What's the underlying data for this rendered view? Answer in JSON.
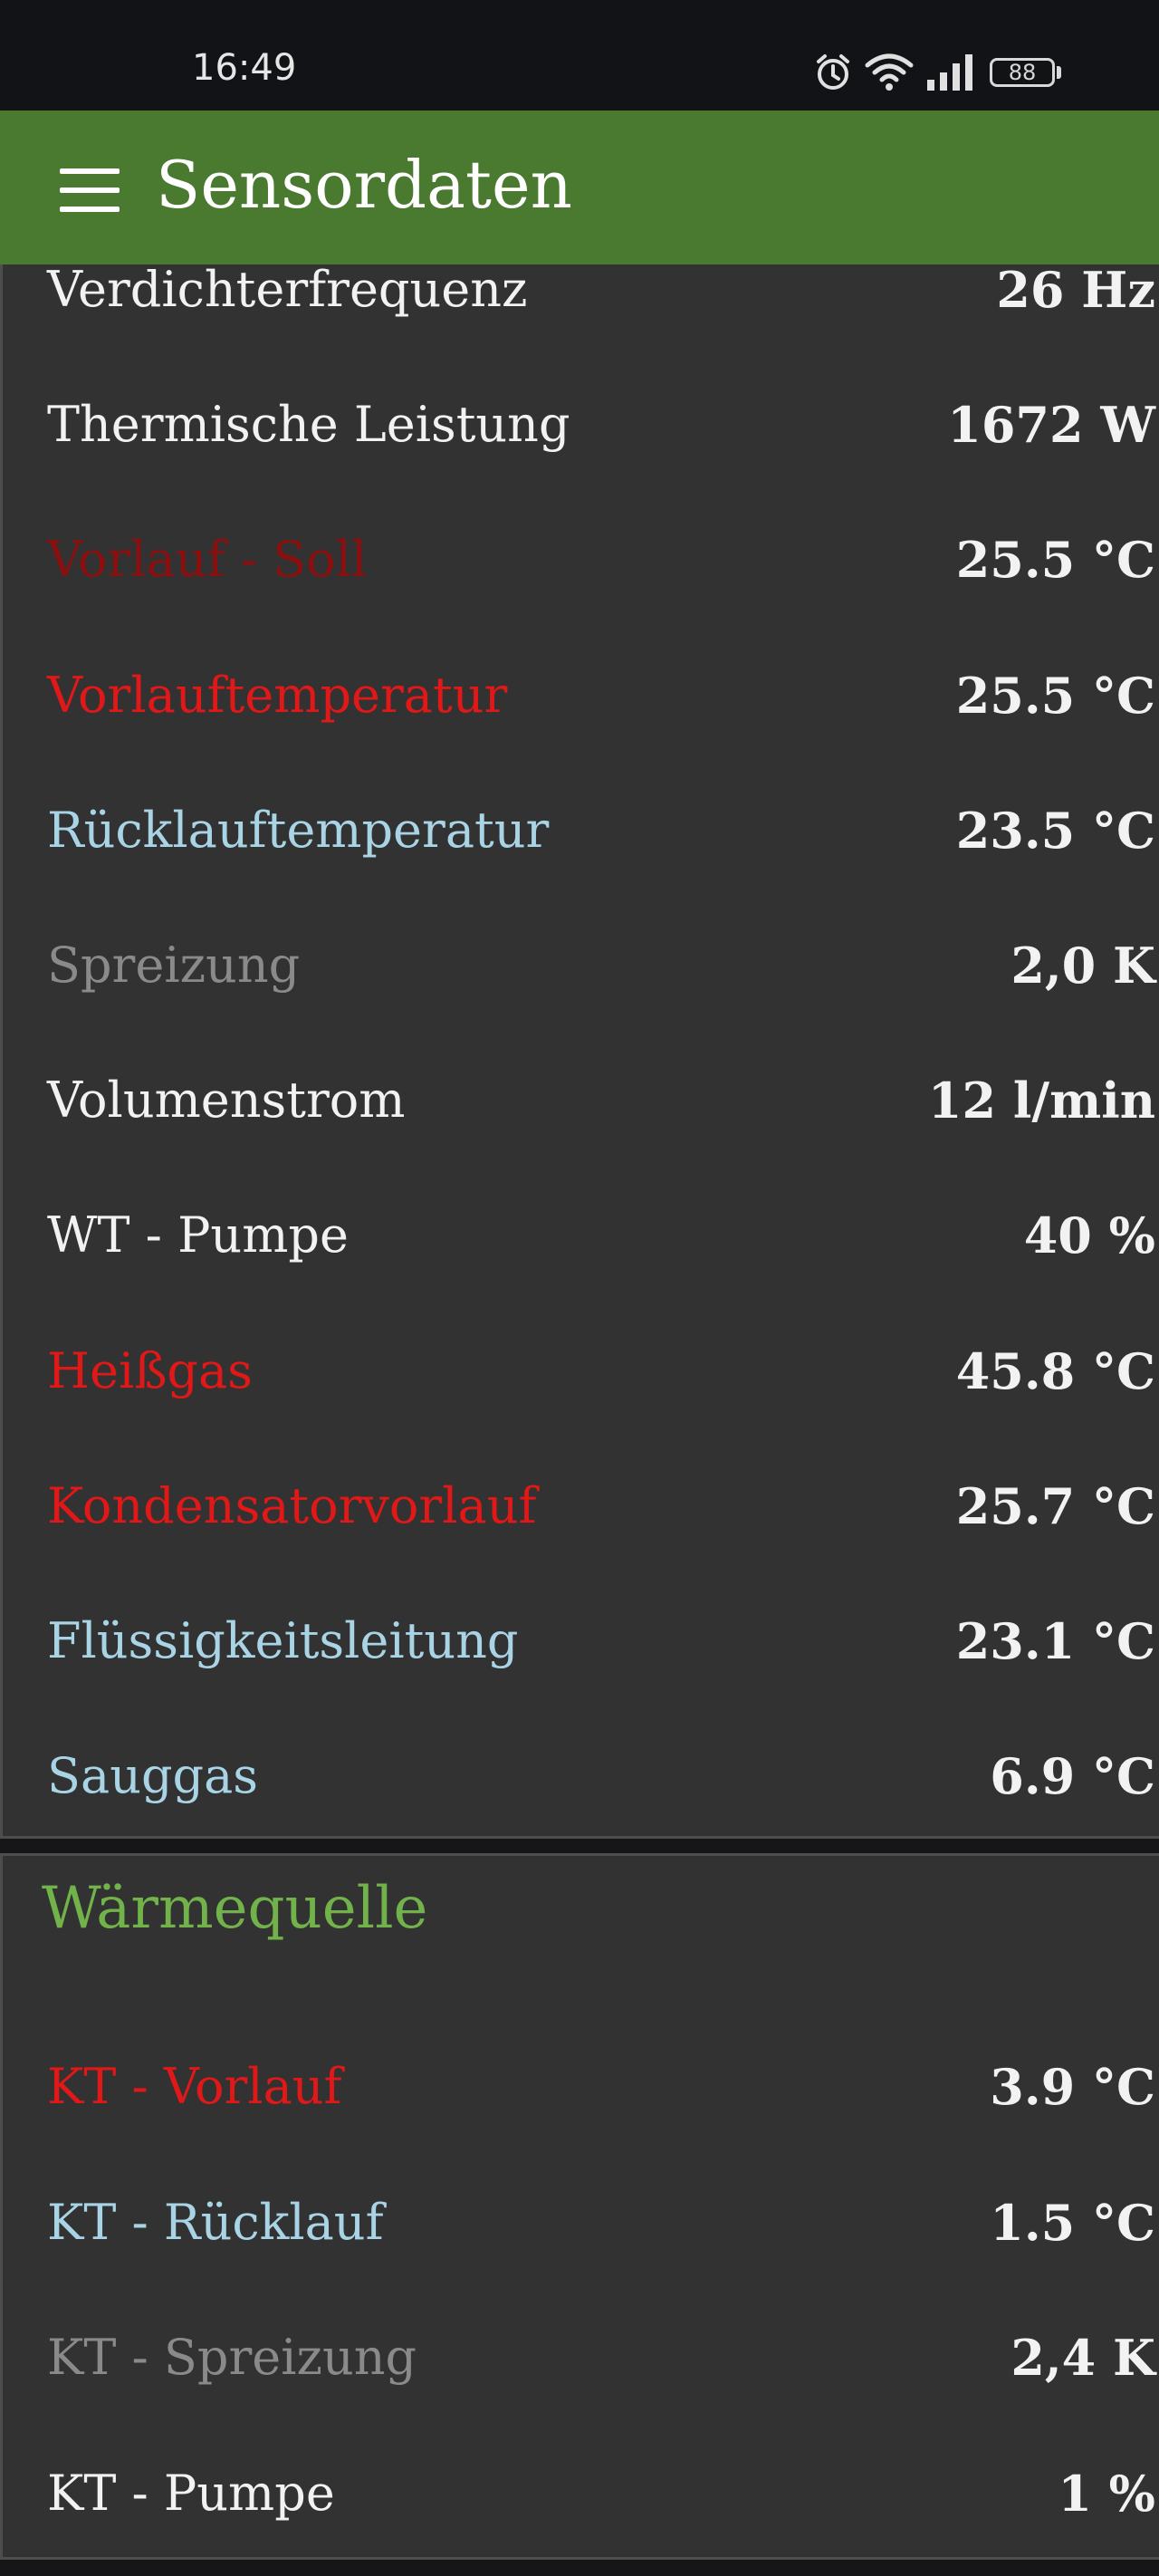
{
  "status_bar": {
    "time": "16:49",
    "battery_level": "88",
    "icons": [
      "alarm-icon",
      "wifi-icon",
      "signal-icon",
      "battery-icon"
    ]
  },
  "app_bar": {
    "title": "Sensordaten",
    "menu_icon": "menu-icon",
    "color": "#4a7a30"
  },
  "heat_pump": {
    "rows": [
      {
        "label": "Verdichterfrequenz",
        "value": "26 Hz",
        "color": "#f2f2f2"
      },
      {
        "label": "Thermische Leistung",
        "value": "1672 W",
        "color": "#f2f2f2"
      },
      {
        "label": "Vorlauf - Soll",
        "value": "25.5 °C",
        "color": "#8a1010"
      },
      {
        "label": "Vorlauftemperatur",
        "value": "25.5 °C",
        "color": "#e01818"
      },
      {
        "label": "Rücklauftemperatur",
        "value": "23.5 °C",
        "color": "#a8d4e6"
      },
      {
        "label": "Spreizung",
        "value": "2,0 K",
        "color": "#8a8a8a"
      },
      {
        "label": "Volumenstrom",
        "value": "12 l/min",
        "color": "#f2f2f2"
      },
      {
        "label": "WT - Pumpe",
        "value": "40 %",
        "color": "#f2f2f2"
      },
      {
        "label": "Heißgas",
        "value": "45.8 °C",
        "color": "#e01818"
      },
      {
        "label": "Kondensatorvorlauf",
        "value": "25.7 °C",
        "color": "#e01818"
      },
      {
        "label": "Flüssigkeitsleitung",
        "value": "23.1 °C",
        "color": "#a8d4e6"
      },
      {
        "label": "Sauggas",
        "value": "6.9 °C",
        "color": "#a8d4e6"
      }
    ]
  },
  "heat_source": {
    "title": "Wärmequelle",
    "title_color": "#72b24a",
    "rows": [
      {
        "label": "KT - Vorlauf",
        "value": "3.9 °C",
        "color": "#e01818"
      },
      {
        "label": "KT - Rücklauf",
        "value": "1.5 °C",
        "color": "#a8d4e6"
      },
      {
        "label": "KT - Spreizung",
        "value": "2,4 K",
        "color": "#8a8a8a"
      },
      {
        "label": "KT - Pumpe",
        "value": "1 %",
        "color": "#f2f2f2"
      }
    ]
  }
}
